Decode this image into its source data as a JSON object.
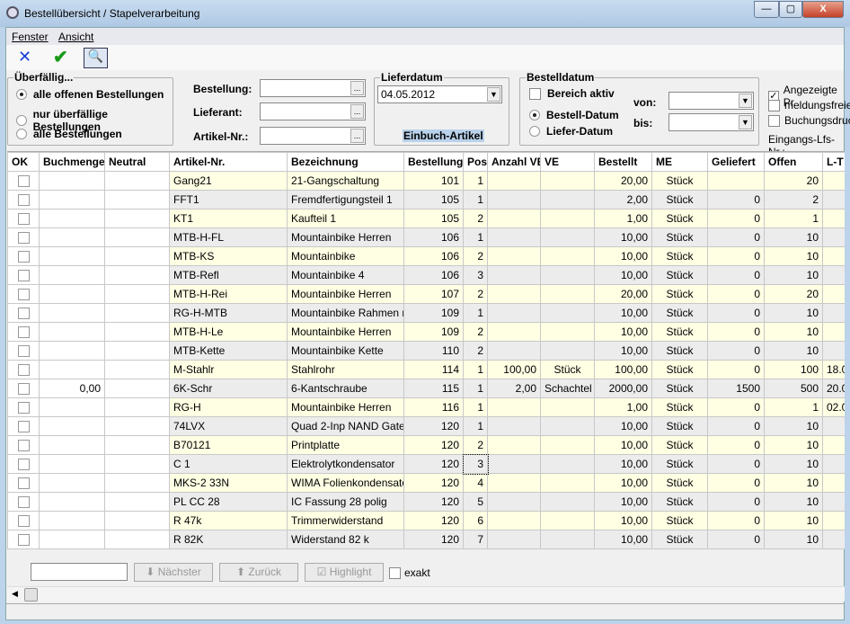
{
  "window": {
    "title": "Bestellübersicht / Stapelverarbeitung",
    "minimize": "—",
    "maximize": "▢",
    "close": "X"
  },
  "menu": [
    "Fenster",
    "Ansicht"
  ],
  "toolbar": {
    "cancel_icon": "x-icon",
    "ok_icon": "check-icon",
    "search_icon": "magnifier-question-icon"
  },
  "ueberfaellig": {
    "title": "Überfällig...",
    "options": [
      "alle offenen Bestellungen",
      "nur überfällige Bestellungen",
      "alle Bestellungen"
    ],
    "selected": 0
  },
  "filters": {
    "bestellung": "Bestellung:",
    "lieferant": "Lieferant:",
    "artikel": "Artikel-Nr.:",
    "browse": "..."
  },
  "lieferdatum": {
    "title": "Lieferdatum",
    "value": "04.05.2012",
    "einbuch": "Einbuch-Artikel"
  },
  "bestelldatum": {
    "title": "Bestelldatum",
    "bereich": "Bereich aktiv",
    "bestell": "Bestell-Datum",
    "liefer": "Liefer-Datum",
    "von": "von:",
    "bis": "bis:"
  },
  "options": {
    "angezeigte": "Angezeigte Pr",
    "meldungsfreie": "meldungsfreie",
    "buchungsdruck": "Buchungsdruc",
    "eingang": "Eingangs-Lfs-Nr.:"
  },
  "columns": [
    "OK",
    "Buchmenge",
    "Neutral",
    "Artikel-Nr.",
    "Bezeichnung",
    "Bestellung",
    "Pos",
    "Anzahl VE",
    "VE",
    "Bestellt",
    "ME",
    "Geliefert",
    "Offen",
    "L-T"
  ],
  "rows": [
    [
      "",
      "",
      "",
      "Gang21",
      "21-Gangschaltung",
      "101",
      "1",
      "",
      "",
      "20,00",
      "Stück",
      "",
      "20",
      ""
    ],
    [
      "",
      "",
      "",
      "FFT1",
      "Fremdfertigungsteil 1",
      "105",
      "1",
      "",
      "",
      "2,00",
      "Stück",
      "0",
      "2",
      ""
    ],
    [
      "",
      "",
      "",
      "KT1",
      "Kaufteil 1",
      "105",
      "2",
      "",
      "",
      "1,00",
      "Stück",
      "0",
      "1",
      ""
    ],
    [
      "",
      "",
      "",
      "MTB-H-FL",
      "Mountainbike Herren",
      "106",
      "1",
      "",
      "",
      "10,00",
      "Stück",
      "0",
      "10",
      ""
    ],
    [
      "",
      "",
      "",
      "MTB-KS",
      "Mountainbike",
      "106",
      "2",
      "",
      "",
      "10,00",
      "Stück",
      "0",
      "10",
      ""
    ],
    [
      "",
      "",
      "",
      "MTB-Refl",
      "Mountainbike 4",
      "106",
      "3",
      "",
      "",
      "10,00",
      "Stück",
      "0",
      "10",
      ""
    ],
    [
      "",
      "",
      "",
      "MTB-H-Rei",
      "Mountainbike Herren",
      "107",
      "2",
      "",
      "",
      "20,00",
      "Stück",
      "0",
      "20",
      ""
    ],
    [
      "",
      "",
      "",
      "RG-H-MTB",
      "Mountainbike Rahmen mit",
      "109",
      "1",
      "",
      "",
      "10,00",
      "Stück",
      "0",
      "10",
      ""
    ],
    [
      "",
      "",
      "",
      "MTB-H-Le",
      "Mountainbike Herren",
      "109",
      "2",
      "",
      "",
      "10,00",
      "Stück",
      "0",
      "10",
      ""
    ],
    [
      "",
      "",
      "",
      "MTB-Kette",
      "Mountainbike Kette",
      "110",
      "2",
      "",
      "",
      "10,00",
      "Stück",
      "0",
      "10",
      ""
    ],
    [
      "",
      "",
      "",
      "M-Stahlr",
      "Stahlrohr",
      "114",
      "1",
      "100,00",
      "Stück",
      "100,00",
      "Stück",
      "0",
      "100",
      "18.0"
    ],
    [
      "",
      "0,00",
      "",
      "6K-Schr",
      "6-Kantschraube",
      "115",
      "1",
      "2,00",
      "Schachtel",
      "2000,00",
      "Stück",
      "1500",
      "500",
      "20.0"
    ],
    [
      "",
      "",
      "",
      "RG-H",
      "Mountainbike Herren",
      "116",
      "1",
      "",
      "",
      "1,00",
      "Stück",
      "0",
      "1",
      "02.0"
    ],
    [
      "",
      "",
      "",
      "74LVX",
      "Quad 2-Inp NAND Gate",
      "120",
      "1",
      "",
      "",
      "10,00",
      "Stück",
      "0",
      "10",
      ""
    ],
    [
      "",
      "",
      "",
      "B70121",
      "Printplatte",
      "120",
      "2",
      "",
      "",
      "10,00",
      "Stück",
      "0",
      "10",
      ""
    ],
    [
      "",
      "",
      "",
      "C 1",
      "Elektrolytkondensator",
      "120",
      "3",
      "",
      "",
      "10,00",
      "Stück",
      "0",
      "10",
      ""
    ],
    [
      "",
      "",
      "",
      "MKS-2 33N",
      "WIMA Folienkondensator,",
      "120",
      "4",
      "",
      "",
      "10,00",
      "Stück",
      "0",
      "10",
      ""
    ],
    [
      "",
      "",
      "",
      "PL CC 28",
      "IC Fassung 28 polig",
      "120",
      "5",
      "",
      "",
      "10,00",
      "Stück",
      "0",
      "10",
      ""
    ],
    [
      "",
      "",
      "",
      "R 47k",
      "Trimmerwiderstand",
      "120",
      "6",
      "",
      "",
      "10,00",
      "Stück",
      "0",
      "10",
      ""
    ],
    [
      "",
      "",
      "",
      "R 82K",
      "Widerstand 82 k",
      "120",
      "7",
      "",
      "",
      "10,00",
      "Stück",
      "0",
      "10",
      ""
    ]
  ],
  "footer": {
    "next": "Nächster",
    "back": "Zurück",
    "highlight": "Highlight",
    "exakt": "exakt"
  },
  "colors": {
    "row_yellow": "#ffffe4",
    "row_gray": "#ececec",
    "selection": "#b9d1ea"
  }
}
